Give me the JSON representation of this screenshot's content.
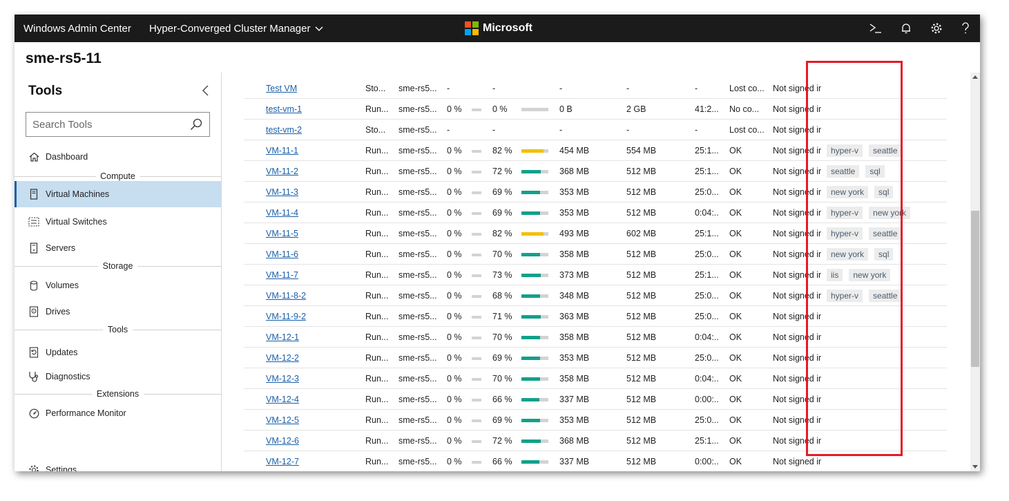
{
  "topbar": {
    "app_title": "Windows Admin Center",
    "app_switcher": "Hyper-Converged Cluster Manager",
    "brand": "Microsoft",
    "brand_colors": [
      "#f25022",
      "#7fba00",
      "#00a4ef",
      "#ffb900"
    ]
  },
  "header": {
    "server_name": "sme-rs5-11"
  },
  "sidebar": {
    "title": "Tools",
    "search_placeholder": "Search Tools",
    "items": [
      {
        "label": "Dashboard",
        "icon": "home-icon"
      },
      {
        "group": "Compute"
      },
      {
        "label": "Virtual Machines",
        "icon": "vm-icon",
        "active": true
      },
      {
        "label": "Virtual Switches",
        "icon": "switch-icon"
      },
      {
        "label": "Servers",
        "icon": "server-icon"
      },
      {
        "group": "Storage"
      },
      {
        "label": "Volumes",
        "icon": "volume-icon"
      },
      {
        "label": "Drives",
        "icon": "drive-icon"
      },
      {
        "group": "Tools"
      },
      {
        "label": "Updates",
        "icon": "updates-icon"
      },
      {
        "label": "Diagnostics",
        "icon": "stethoscope-icon"
      },
      {
        "group": "Extensions"
      },
      {
        "label": "Performance Monitor",
        "icon": "gauge-icon"
      },
      {
        "label": "Settings",
        "icon": "gear-icon"
      }
    ]
  },
  "accent_color": "#1a5fa8",
  "status_colors": {
    "memory_ok": "#12a08b",
    "memory_warn": "#f2c00f"
  },
  "vms": [
    {
      "name": "Test VM",
      "state": "Sto...",
      "host": "sme-rs5...",
      "cpu": "-",
      "mem": "-",
      "mem_demand": "-",
      "mem_assigned": "-",
      "uptime": "-",
      "heartbeat": "Lost co...",
      "protection": "Not signed in",
      "tags": []
    },
    {
      "name": "test-vm-1",
      "state": "Run...",
      "host": "sme-rs5...",
      "cpu": "0 %",
      "mem": "0 %",
      "mem_pct": 0,
      "mem_demand": "0 B",
      "mem_assigned": "2 GB",
      "uptime": "41:2...",
      "heartbeat": "No co...",
      "protection": "Not signed in",
      "tags": []
    },
    {
      "name": "test-vm-2",
      "state": "Sto...",
      "host": "sme-rs5...",
      "cpu": "-",
      "mem": "-",
      "mem_demand": "-",
      "mem_assigned": "-",
      "uptime": "-",
      "heartbeat": "Lost co...",
      "protection": "Not signed in",
      "tags": []
    },
    {
      "name": "VM-11-1",
      "state": "Run...",
      "host": "sme-rs5...",
      "cpu": "0 %",
      "mem": "82 %",
      "mem_pct": 82,
      "mem_demand": "454 MB",
      "mem_assigned": "554 MB",
      "uptime": "25:1...",
      "heartbeat": "OK",
      "protection": "Not signed in",
      "tags": [
        "hyper-v",
        "seattle"
      ]
    },
    {
      "name": "VM-11-2",
      "state": "Run...",
      "host": "sme-rs5...",
      "cpu": "0 %",
      "mem": "72 %",
      "mem_pct": 72,
      "mem_demand": "368 MB",
      "mem_assigned": "512 MB",
      "uptime": "25:1...",
      "heartbeat": "OK",
      "protection": "Not signed in",
      "tags": [
        "seattle",
        "sql"
      ]
    },
    {
      "name": "VM-11-3",
      "state": "Run...",
      "host": "sme-rs5...",
      "cpu": "0 %",
      "mem": "69 %",
      "mem_pct": 69,
      "mem_demand": "353 MB",
      "mem_assigned": "512 MB",
      "uptime": "25:0...",
      "heartbeat": "OK",
      "protection": "Not signed in",
      "tags": [
        "new york",
        "sql"
      ]
    },
    {
      "name": "VM-11-4",
      "state": "Run...",
      "host": "sme-rs5...",
      "cpu": "0 %",
      "mem": "69 %",
      "mem_pct": 69,
      "mem_demand": "353 MB",
      "mem_assigned": "512 MB",
      "uptime": "0:04:...",
      "heartbeat": "OK",
      "protection": "Not signed in",
      "tags": [
        "hyper-v",
        "new york"
      ]
    },
    {
      "name": "VM-11-5",
      "state": "Run...",
      "host": "sme-rs5...",
      "cpu": "0 %",
      "mem": "82 %",
      "mem_pct": 82,
      "mem_demand": "493 MB",
      "mem_assigned": "602 MB",
      "uptime": "25:1...",
      "heartbeat": "OK",
      "protection": "Not signed in",
      "tags": [
        "hyper-v",
        "seattle"
      ]
    },
    {
      "name": "VM-11-6",
      "state": "Run...",
      "host": "sme-rs5...",
      "cpu": "0 %",
      "mem": "70 %",
      "mem_pct": 70,
      "mem_demand": "358 MB",
      "mem_assigned": "512 MB",
      "uptime": "25:0...",
      "heartbeat": "OK",
      "protection": "Not signed in",
      "tags": [
        "new york",
        "sql"
      ]
    },
    {
      "name": "VM-11-7",
      "state": "Run...",
      "host": "sme-rs5...",
      "cpu": "0 %",
      "mem": "73 %",
      "mem_pct": 73,
      "mem_demand": "373 MB",
      "mem_assigned": "512 MB",
      "uptime": "25:1...",
      "heartbeat": "OK",
      "protection": "Not signed in",
      "tags": [
        "iis",
        "new york"
      ]
    },
    {
      "name": "VM-11-8-2",
      "state": "Run...",
      "host": "sme-rs5...",
      "cpu": "0 %",
      "mem": "68 %",
      "mem_pct": 68,
      "mem_demand": "348 MB",
      "mem_assigned": "512 MB",
      "uptime": "25:0...",
      "heartbeat": "OK",
      "protection": "Not signed in",
      "tags": [
        "hyper-v",
        "seattle"
      ]
    },
    {
      "name": "VM-11-9-2",
      "state": "Run...",
      "host": "sme-rs5...",
      "cpu": "0 %",
      "mem": "71 %",
      "mem_pct": 71,
      "mem_demand": "363 MB",
      "mem_assigned": "512 MB",
      "uptime": "25:0...",
      "heartbeat": "OK",
      "protection": "Not signed in",
      "tags": []
    },
    {
      "name": "VM-12-1",
      "state": "Run...",
      "host": "sme-rs5...",
      "cpu": "0 %",
      "mem": "70 %",
      "mem_pct": 70,
      "mem_demand": "358 MB",
      "mem_assigned": "512 MB",
      "uptime": "0:04:...",
      "heartbeat": "OK",
      "protection": "Not signed in",
      "tags": []
    },
    {
      "name": "VM-12-2",
      "state": "Run...",
      "host": "sme-rs5...",
      "cpu": "0 %",
      "mem": "69 %",
      "mem_pct": 69,
      "mem_demand": "353 MB",
      "mem_assigned": "512 MB",
      "uptime": "25:0...",
      "heartbeat": "OK",
      "protection": "Not signed in",
      "tags": []
    },
    {
      "name": "VM-12-3",
      "state": "Run...",
      "host": "sme-rs5...",
      "cpu": "0 %",
      "mem": "70 %",
      "mem_pct": 70,
      "mem_demand": "358 MB",
      "mem_assigned": "512 MB",
      "uptime": "0:04:...",
      "heartbeat": "OK",
      "protection": "Not signed in",
      "tags": []
    },
    {
      "name": "VM-12-4",
      "state": "Run...",
      "host": "sme-rs5...",
      "cpu": "0 %",
      "mem": "66 %",
      "mem_pct": 66,
      "mem_demand": "337 MB",
      "mem_assigned": "512 MB",
      "uptime": "0:00:...",
      "heartbeat": "OK",
      "protection": "Not signed in",
      "tags": []
    },
    {
      "name": "VM-12-5",
      "state": "Run...",
      "host": "sme-rs5...",
      "cpu": "0 %",
      "mem": "69 %",
      "mem_pct": 69,
      "mem_demand": "353 MB",
      "mem_assigned": "512 MB",
      "uptime": "25:0...",
      "heartbeat": "OK",
      "protection": "Not signed in",
      "tags": []
    },
    {
      "name": "VM-12-6",
      "state": "Run...",
      "host": "sme-rs5...",
      "cpu": "0 %",
      "mem": "72 %",
      "mem_pct": 72,
      "mem_demand": "368 MB",
      "mem_assigned": "512 MB",
      "uptime": "25:1...",
      "heartbeat": "OK",
      "protection": "Not signed in",
      "tags": []
    },
    {
      "name": "VM-12-7",
      "state": "Run...",
      "host": "sme-rs5...",
      "cpu": "0 %",
      "mem": "66 %",
      "mem_pct": 66,
      "mem_demand": "337 MB",
      "mem_assigned": "512 MB",
      "uptime": "0:00:...",
      "heartbeat": "OK",
      "protection": "Not signed in",
      "tags": []
    }
  ]
}
